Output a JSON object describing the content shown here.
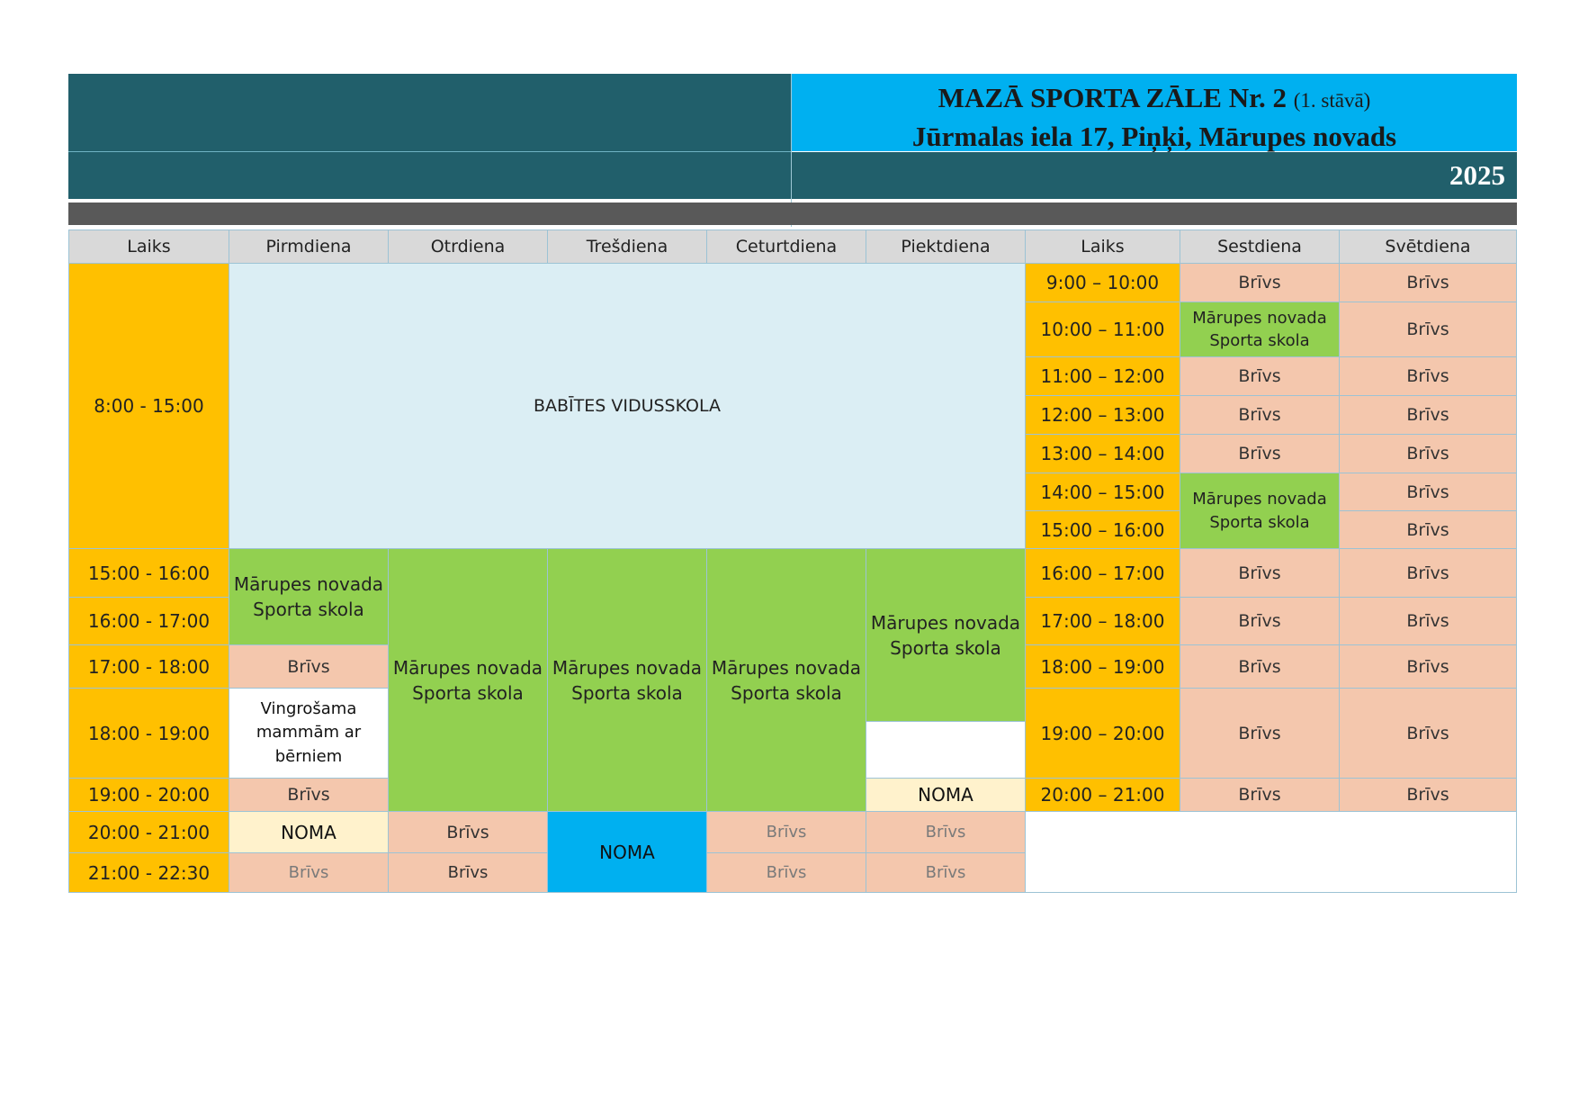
{
  "header": {
    "title_main": "MAZĀ SPORTA ZĀLE Nr. 2",
    "title_floor": "(1. stāvā)",
    "address": "Jūrmalas iela 17, Piņķi, Mārupes novads",
    "year": "2025"
  },
  "columns": {
    "time": "Laiks",
    "mon": "Pirmdiena",
    "tue": "Otrdiena",
    "wed": "Trešdiena",
    "thu": "Ceturtdiena",
    "fri": "Piektdiena",
    "time2": "Laiks",
    "sat": "Sestdiena",
    "sun": "Svētdiena"
  },
  "weekday": {
    "times": [
      "8:00 - 15:00",
      "15:00 - 16:00",
      "16:00 - 17:00",
      "17:00 - 18:00",
      "18:00 - 19:00",
      "19:00 - 20:00",
      "20:00 - 21:00",
      "21:00 - 22:30"
    ],
    "school_block": "BABĪTES VIDUSSKOLA",
    "sports_school": "Mārupes novada Sporta skola",
    "free": "Brīvs",
    "moms": "Vingrošama mammām ar bērniem",
    "rent": "NOMA"
  },
  "weekend": {
    "times": [
      "9:00 – 10:00",
      "10:00 – 11:00",
      "11:00 – 12:00",
      "12:00 – 13:00",
      "13:00 – 14:00",
      "14:00 – 15:00",
      "15:00 – 16:00",
      "16:00 – 17:00",
      "17:00 – 18:00",
      "18:00 – 19:00",
      "19:00 – 20:00",
      "20:00 – 21:00"
    ],
    "free": "Brīvs",
    "sports_school": "Mārupes novada Sporta skola"
  },
  "colors": {
    "header_teal": "#215f6b",
    "header_blue": "#00b0f0",
    "time_orange": "#ffc000",
    "free_peach": "#f4c7ad",
    "school_green": "#92d050",
    "school_block_blue": "#dbeef4",
    "rent_cream": "#fff2cc",
    "rent_blue": "#00b0f0"
  }
}
